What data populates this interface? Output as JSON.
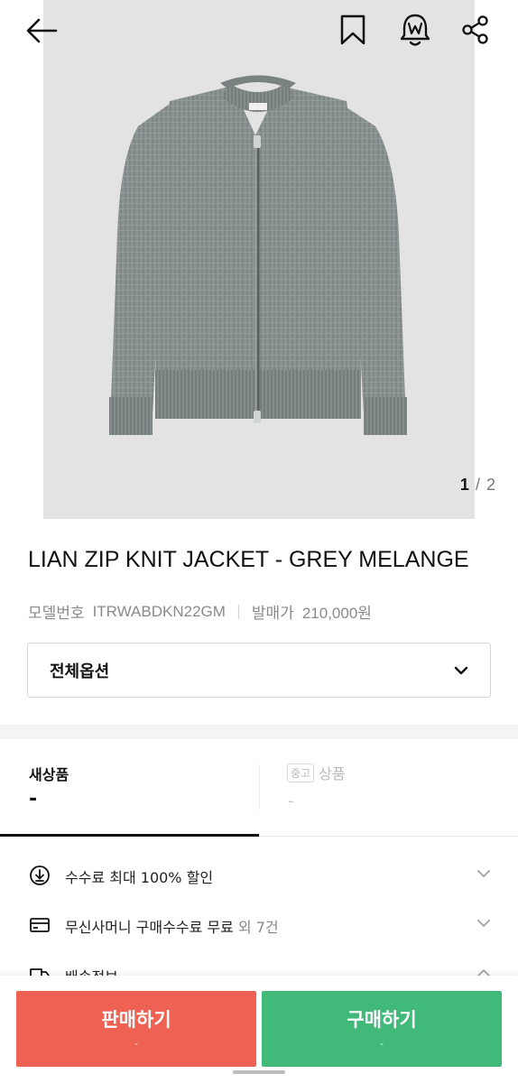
{
  "topbar": {
    "back_icon": "arrow-left-icon",
    "bookmark_icon": "bookmark-icon",
    "alert_icon": "bell-w-icon",
    "share_icon": "share-icon"
  },
  "gallery": {
    "current": "1",
    "separator": "/",
    "total": "2",
    "image_subject": "grey knit zip jacket"
  },
  "product": {
    "title": "LIAN ZIP KNIT JACKET - GREY MELANGE",
    "model_label": "모델번호",
    "model_value": "ITRWABDKN22GM",
    "price_label": "발매가",
    "price_value": "210,000원"
  },
  "options": {
    "label": "전체옵션",
    "icon": "chevron-down-icon"
  },
  "tabs": [
    {
      "label": "새상품",
      "value": "-",
      "active": true
    },
    {
      "badge": "중고",
      "label": "상품",
      "value": "-",
      "active": false
    }
  ],
  "info_rows": [
    {
      "icon": "coin-download-icon",
      "text": "수수료 최대 100% 할인",
      "muted": "",
      "chevron": "chevron-down-icon"
    },
    {
      "icon": "card-icon",
      "text": "무신사머니 구매수수료 무료",
      "muted": " 외 7건",
      "chevron": "chevron-down-icon"
    },
    {
      "icon": "truck-icon",
      "text": "배송정보",
      "muted": "",
      "chevron": "chevron-up-icon"
    }
  ],
  "actions": {
    "sell": {
      "title": "판매하기",
      "sub": "-"
    },
    "buy": {
      "title": "구매하기",
      "sub": "-"
    }
  },
  "colors": {
    "sell": "#ef6253",
    "buy": "#41b979",
    "photo_bg": "#e3e3e3",
    "knit": "#8a9090"
  }
}
